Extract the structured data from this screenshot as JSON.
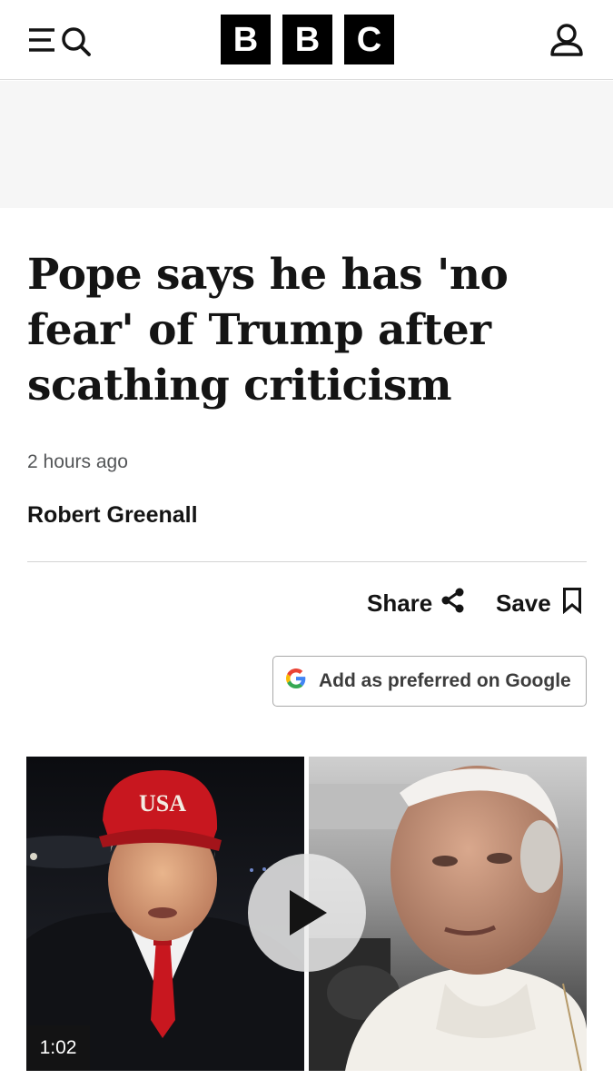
{
  "header": {
    "menu_icon": "menu-search-icon",
    "logo_letters": [
      "B",
      "B",
      "C"
    ],
    "account_icon": "account-icon"
  },
  "article": {
    "headline": "Pope says he has 'no fear' of Trump after scathing criticism",
    "timestamp": "2 hours ago",
    "byline": "Robert Greenall"
  },
  "actions": {
    "share_label": "Share",
    "share_icon": "share-icon",
    "save_label": "Save",
    "save_icon": "bookmark-icon",
    "google_label": "Add as preferred on Google",
    "google_icon": "google-g-icon"
  },
  "video": {
    "duration": "1:02",
    "play_icon": "play-icon",
    "cap_text": "USA"
  },
  "colors": {
    "text": "#141414",
    "muted": "#545658",
    "cap_red": "#c8171f",
    "google_blue": "#4285F4",
    "google_red": "#EA4335",
    "google_yellow": "#FBBC05",
    "google_green": "#34A853"
  }
}
